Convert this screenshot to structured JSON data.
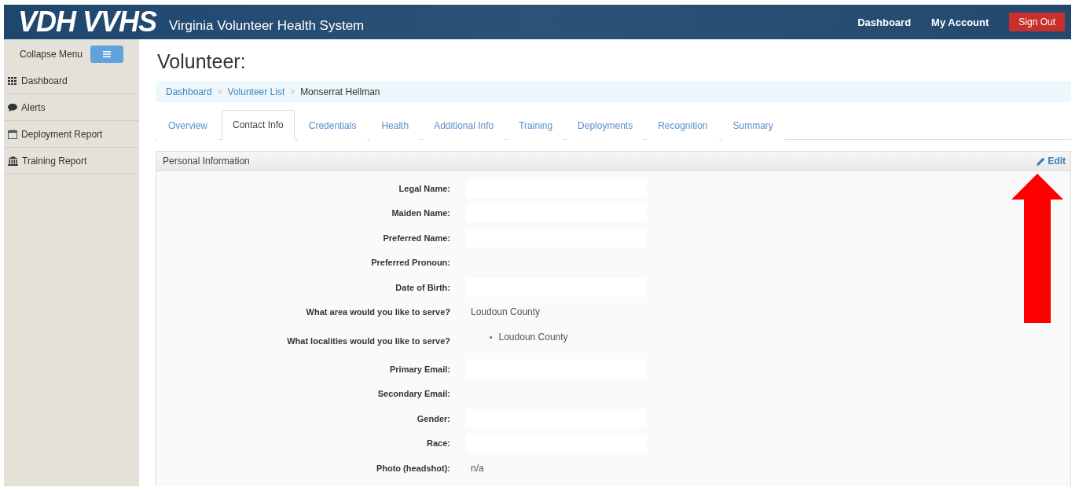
{
  "header": {
    "logo": "VDH VVHS",
    "subtitle": "Virginia Volunteer Health System",
    "nav": [
      "Dashboard",
      "My Account"
    ],
    "sign_out": "Sign Out"
  },
  "sidebar": {
    "collapse_label": "Collapse Menu",
    "items": [
      {
        "label": "Dashboard",
        "kind": "grid"
      },
      {
        "label": "Alerts",
        "kind": "chat"
      },
      {
        "label": "Deployment Report",
        "kind": "calendar"
      },
      {
        "label": "Training Report",
        "kind": "bank"
      }
    ]
  },
  "page_title": "Volunteer:",
  "breadcrumb": {
    "links": [
      "Dashboard",
      "Volunteer List"
    ],
    "separator": ">",
    "current": "Monserrat Hellman"
  },
  "tabs": [
    {
      "label": "Overview",
      "selected": false
    },
    {
      "label": "Contact Info",
      "selected": true
    },
    {
      "label": "Credentials",
      "selected": false
    },
    {
      "label": "Health",
      "selected": false
    },
    {
      "label": "Additional Info",
      "selected": false
    },
    {
      "label": "Training",
      "selected": false
    },
    {
      "label": "Deployments",
      "selected": false
    },
    {
      "label": "Recognition",
      "selected": false
    },
    {
      "label": "Summary",
      "selected": false
    }
  ],
  "panel": {
    "title": "Personal Information",
    "edit": "Edit",
    "fields": [
      {
        "label": "Legal Name:",
        "kind": "box"
      },
      {
        "label": "Maiden Name:",
        "kind": "box"
      },
      {
        "label": "Preferred Name:",
        "kind": "box"
      },
      {
        "label": "Preferred Pronoun:",
        "kind": "empty"
      },
      {
        "label": "Date of Birth:",
        "kind": "box"
      },
      {
        "label": "What area would you like to serve?",
        "kind": "text",
        "value": "Loudoun County"
      },
      {
        "label": "What localities would you like to serve?",
        "kind": "list",
        "bullet": "•",
        "items": [
          "Loudoun County"
        ]
      },
      {
        "label": "Primary Email:",
        "kind": "box"
      },
      {
        "label": "Secondary Email:",
        "kind": "empty"
      },
      {
        "label": "Gender:",
        "kind": "box"
      },
      {
        "label": "Race:",
        "kind": "box"
      },
      {
        "label": "Photo (headshot):",
        "kind": "text",
        "value": "n/a"
      }
    ]
  }
}
